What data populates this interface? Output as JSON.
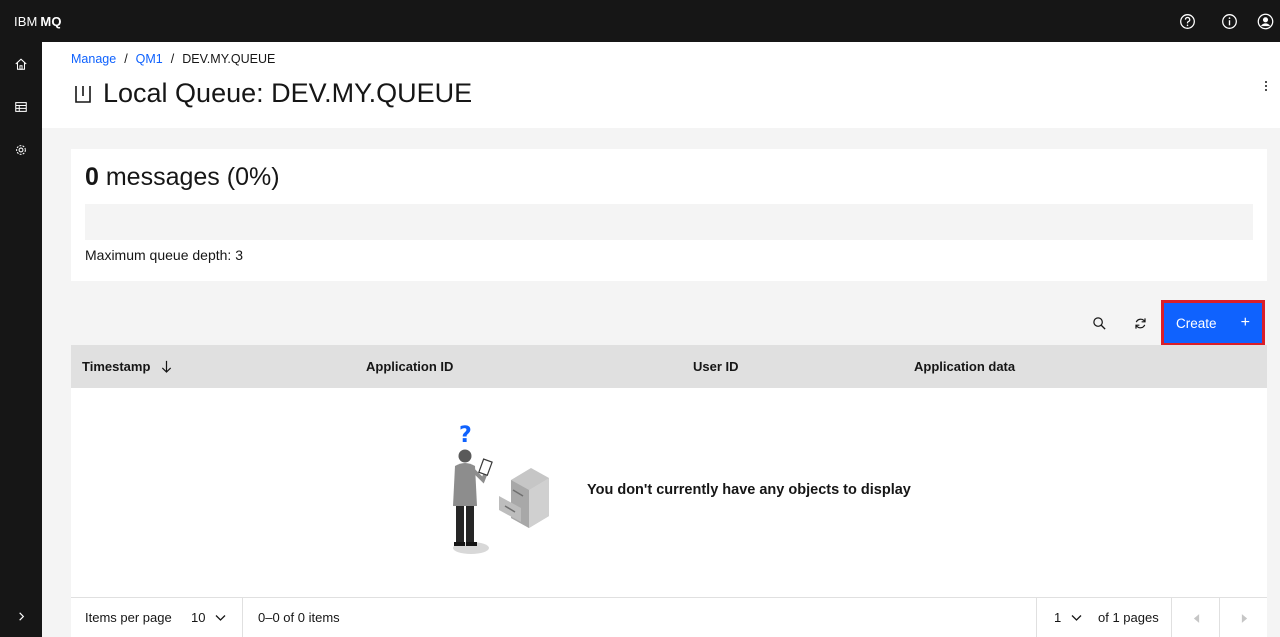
{
  "topbar": {
    "brand_prefix": "IBM",
    "brand_product": "MQ",
    "actions": [
      "help-icon",
      "info-icon",
      "user-icon"
    ]
  },
  "sidenav": {
    "items": [
      "home-icon",
      "table-icon",
      "settings-icon"
    ],
    "expand": "chevron-right-icon"
  },
  "breadcrumb": {
    "items": [
      "Manage",
      "QM1"
    ],
    "separator": "/",
    "current": "DEV.MY.QUEUE"
  },
  "page": {
    "title": "Local Queue: DEV.MY.QUEUE",
    "title_icon": "queue-icon"
  },
  "depth": {
    "count": "0",
    "summary": "messages (0%)",
    "fill_fraction": 0,
    "max_label": "Maximum queue depth: 3"
  },
  "toolbar": {
    "search_icon": "search-icon",
    "refresh_icon": "refresh-icon",
    "create_label": "Create",
    "create_icon": "+"
  },
  "table": {
    "columns": [
      "Timestamp",
      "Application ID",
      "User ID",
      "Application data"
    ],
    "sort_icon": "arrow-down-icon",
    "empty_message": "You don't currently have any objects to display"
  },
  "pagination": {
    "items_per_page_label": "Items per page",
    "page_size": "10",
    "range": "0–0 of 0 items",
    "page": "1",
    "of_pages": "of 1 pages"
  },
  "colors": {
    "topbar": "#161616",
    "primary": "#0f62fe",
    "highlight": "#da1e28",
    "link": "#0f62fe",
    "table_header": "#e0e0e0"
  }
}
